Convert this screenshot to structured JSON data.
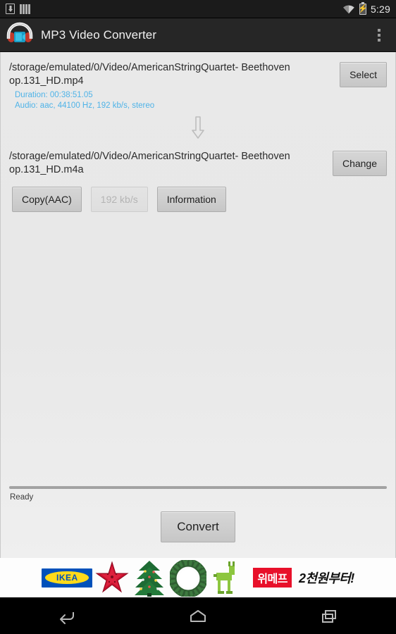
{
  "status_bar": {
    "icons": [
      "download-icon",
      "equalizer-icon",
      "wifi-icon",
      "battery-charging-icon"
    ],
    "time": "5:29"
  },
  "action_bar": {
    "app_icon": "headphones-video-icon",
    "title": "MP3 Video Converter",
    "overflow_label": "overflow-menu"
  },
  "input_section": {
    "path": "/storage/emulated/0/Video/AmericanStringQuartet- Beethoven op.131_HD.mp4",
    "duration": "Duration: 00:38:51.05",
    "audio": "Audio: aac, 44100 Hz, 192 kb/s, stereo",
    "select_label": "Select",
    "info_color": "#4fb3e8"
  },
  "arrow": {
    "icon": "arrow-down-icon"
  },
  "output_section": {
    "path": "/storage/emulated/0/Video/AmericanStringQuartet- Beethoven op.131_HD.m4a",
    "change_label": "Change"
  },
  "options": {
    "codec_label": "Copy(AAC)",
    "bitrate_label": "192 kb/s",
    "bitrate_enabled": false,
    "information_label": "Information"
  },
  "progress": {
    "value": 0,
    "status_text": "Ready"
  },
  "convert": {
    "label": "Convert"
  },
  "ad_banner": {
    "brand": "IKEA",
    "ornaments": [
      "star-ornament",
      "christmas-tree",
      "wreath",
      "reindeer"
    ],
    "advertiser": "위메프",
    "price_text": "2천원부터!",
    "advertiser_bg": "#e8102a"
  },
  "nav_bar": {
    "back": "back-icon",
    "home": "home-icon",
    "recents": "recents-icon"
  }
}
